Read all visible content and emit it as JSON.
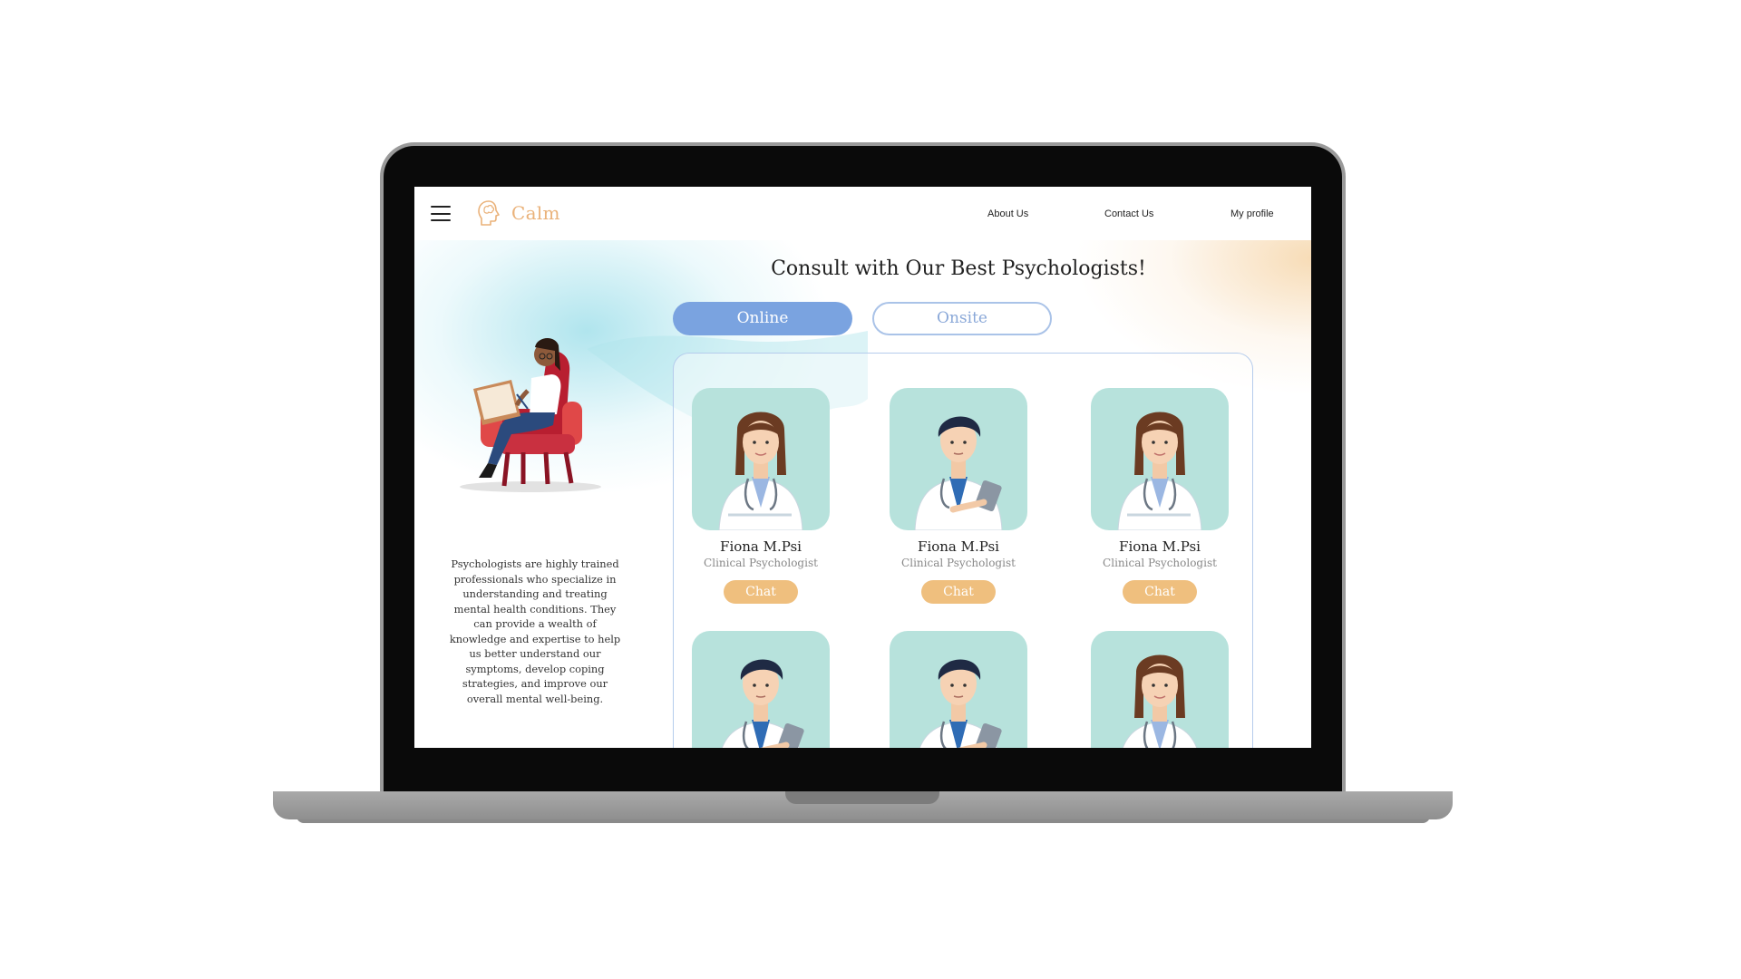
{
  "app": {
    "name": "Calm",
    "logo_icon": "head-brain-icon"
  },
  "nav": {
    "menu_icon": "hamburger-menu-icon",
    "links": [
      "About Us",
      "Contact Us",
      "My profile"
    ]
  },
  "main": {
    "title": "Consult with Our Best Psychologists!",
    "tabs": {
      "online": "Online",
      "onsite": "Onsite",
      "selected": "Online"
    },
    "blurb": "Psychologists are highly trained professionals who specialize in understanding and treating mental health conditions. They can provide a wealth of knowledge and expertise to help us better understand our symptoms, develop coping strategies, and improve our overall mental well-being."
  },
  "doctors": [
    {
      "name": "Fiona M.Psi",
      "role": "Clinical Psychologist",
      "action": "Chat",
      "avatar": "female-doctor"
    },
    {
      "name": "Fiona M.Psi",
      "role": "Clinical Psychologist",
      "action": "Chat",
      "avatar": "male-doctor-tablet"
    },
    {
      "name": "Fiona M.Psi",
      "role": "Clinical Psychologist",
      "action": "Chat",
      "avatar": "female-doctor"
    },
    {
      "name": "",
      "role": "",
      "action": "",
      "avatar": "male-doctor-tablet"
    },
    {
      "name": "",
      "role": "",
      "action": "",
      "avatar": "male-doctor-tablet"
    },
    {
      "name": "",
      "role": "",
      "action": "",
      "avatar": "female-doctor"
    }
  ],
  "colors": {
    "accent": "#eab27a",
    "toggle_active": "#7aa3e0",
    "chat_button": "#efbf7e",
    "card_background": "#b7e2dc"
  }
}
